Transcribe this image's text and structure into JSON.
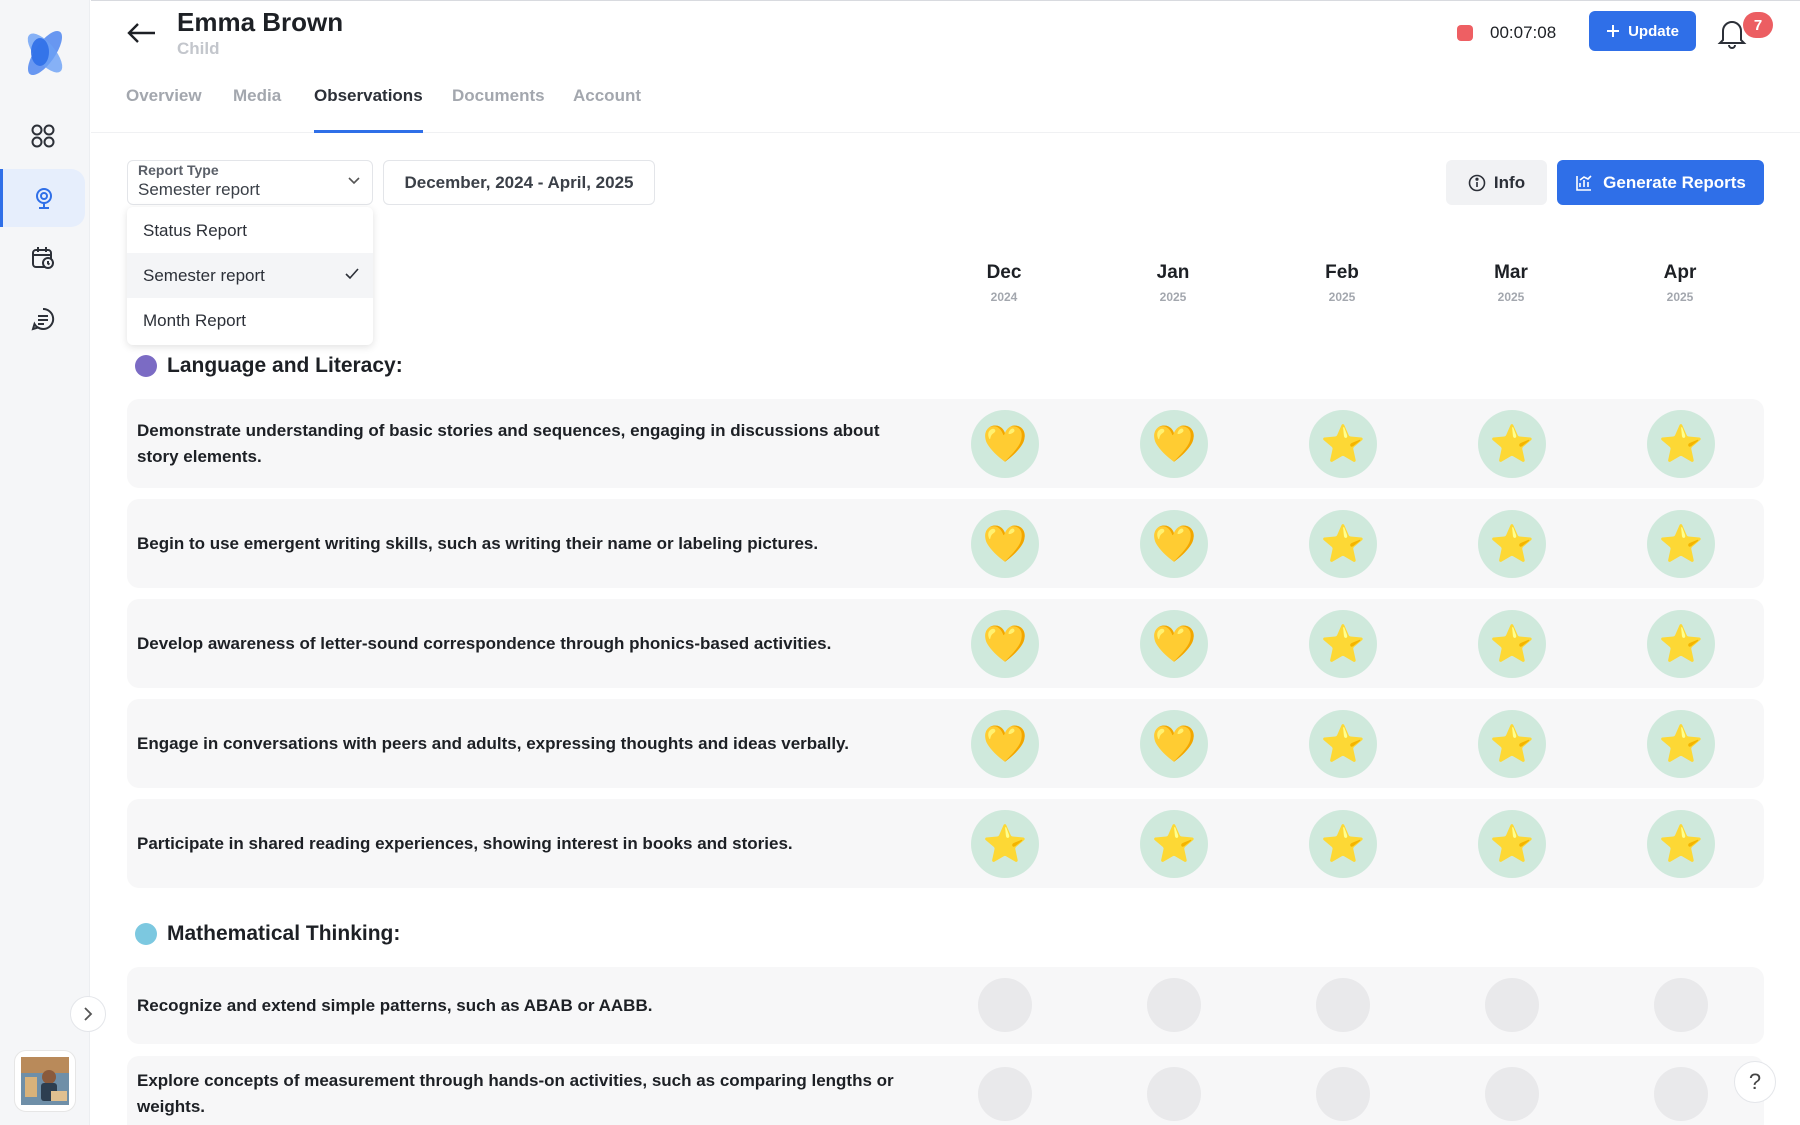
{
  "header": {
    "child_name": "Emma Brown",
    "child_role": "Child",
    "timer": "00:07:08",
    "update_label": "Update",
    "notification_count": "7"
  },
  "tabs": [
    {
      "label": "Overview"
    },
    {
      "label": "Media"
    },
    {
      "label": "Observations"
    },
    {
      "label": "Documents"
    },
    {
      "label": "Account"
    }
  ],
  "filters": {
    "report_type_label": "Report Type",
    "report_type_value": "Semester report",
    "date_range": "December, 2024 - April, 2025",
    "info_label": "Info",
    "generate_label": "Generate Reports"
  },
  "dropdown": {
    "options": [
      "Status Report",
      "Semester report",
      "Month Report"
    ],
    "selected": "Semester report"
  },
  "months": [
    {
      "month": "Dec",
      "year": "2024"
    },
    {
      "month": "Jan",
      "year": "2025"
    },
    {
      "month": "Feb",
      "year": "2025"
    },
    {
      "month": "Mar",
      "year": "2025"
    },
    {
      "month": "Apr",
      "year": "2025"
    }
  ],
  "sections": [
    {
      "title": "Language and Literacy:",
      "color": "#7b6bc4",
      "rows": [
        {
          "text": "Demonstrate understanding of basic stories and sequences, engaging in discussions about story elements.",
          "ratings": [
            "heart",
            "heart",
            "star",
            "star",
            "star"
          ]
        },
        {
          "text": "Begin to use emergent writing skills, such as writing their name or labeling pictures.",
          "ratings": [
            "heart",
            "heart",
            "star",
            "star",
            "star"
          ]
        },
        {
          "text": "Develop awareness of letter-sound correspondence through phonics-based activities.",
          "ratings": [
            "heart",
            "heart",
            "star",
            "star",
            "star"
          ]
        },
        {
          "text": "Engage in conversations with peers and adults, expressing thoughts and ideas verbally.",
          "ratings": [
            "heart",
            "heart",
            "star",
            "star",
            "star"
          ]
        },
        {
          "text": "Participate in shared reading experiences, showing interest in books and stories.",
          "ratings": [
            "star",
            "star",
            "star",
            "star",
            "star"
          ]
        }
      ]
    },
    {
      "title": "Mathematical Thinking:",
      "color": "#7cc8e0",
      "rows": [
        {
          "text": "Recognize and extend simple patterns, such as ABAB or AABB.",
          "ratings": [
            "empty",
            "empty",
            "empty",
            "empty",
            "empty"
          ]
        },
        {
          "text": "Explore concepts of measurement through hands-on activities, such as comparing lengths or weights.",
          "ratings": [
            "empty",
            "empty",
            "empty",
            "empty",
            "empty"
          ]
        }
      ]
    }
  ],
  "icons": {
    "sidebar": [
      "dashboard-icon",
      "observations-icon",
      "calendar-icon",
      "messages-icon"
    ],
    "rating_symbols": {
      "heart": "💛",
      "star": "⭐"
    }
  },
  "colors": {
    "accent": "#2f6fe8",
    "rating_bg": "#cfe9dc",
    "empty_bg": "#e9e9eb",
    "recording": "#ee5f63"
  }
}
